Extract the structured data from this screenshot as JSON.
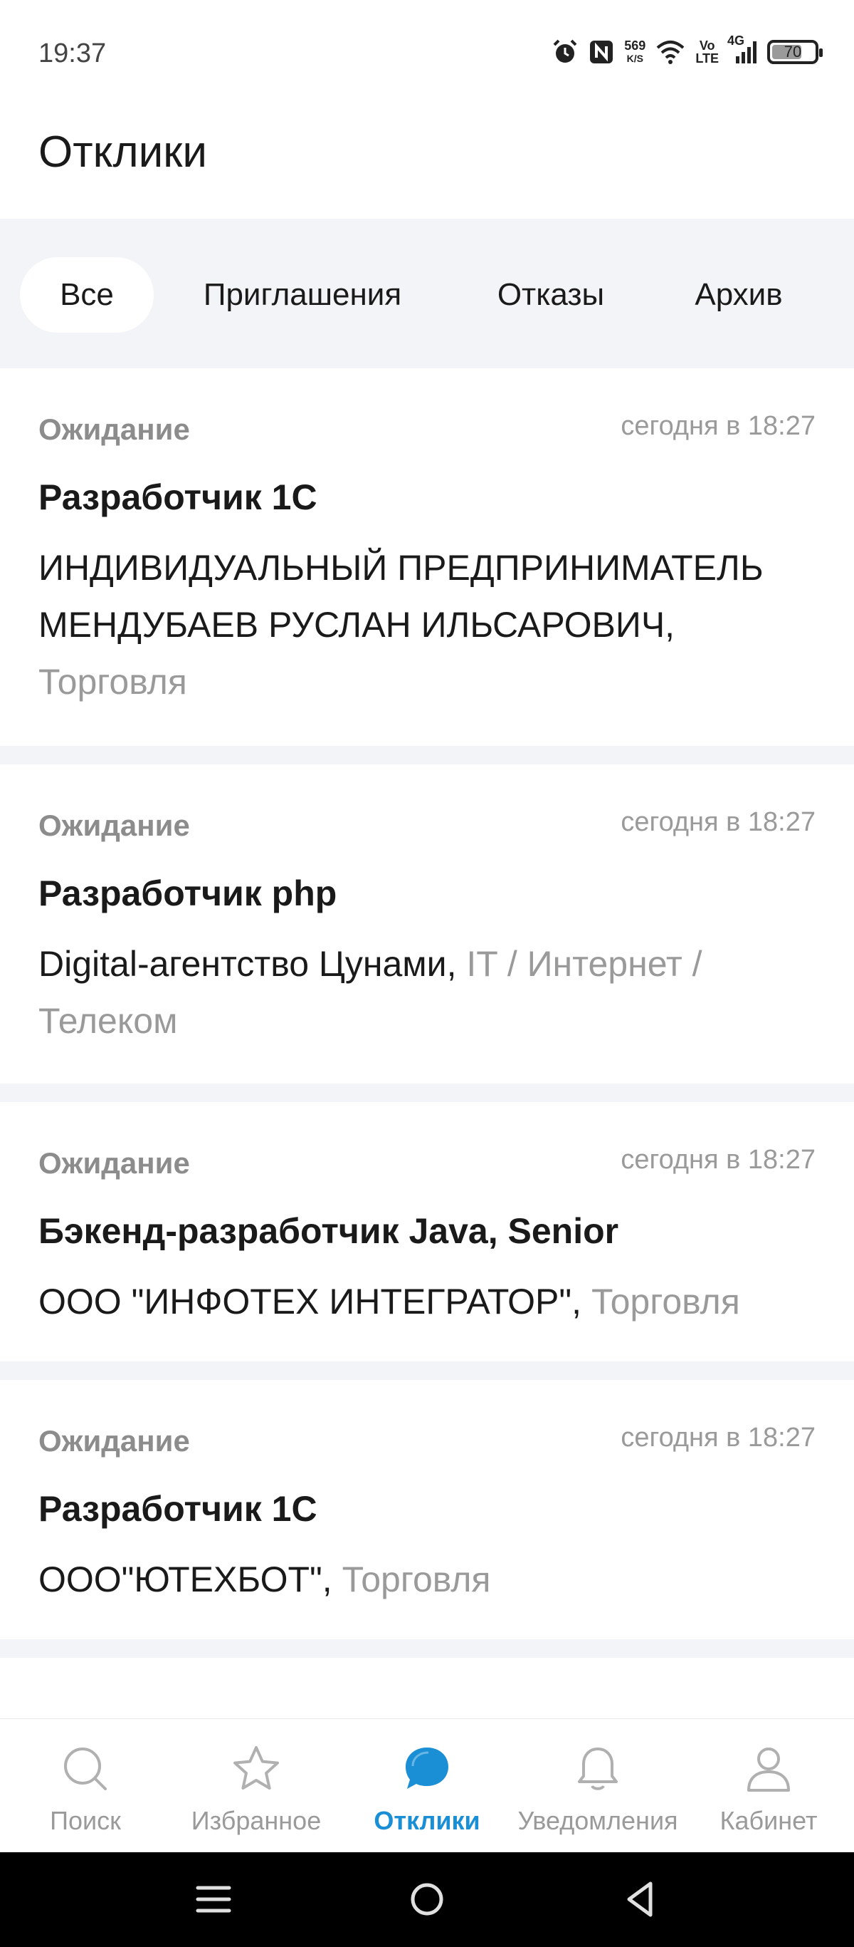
{
  "status_bar": {
    "time": "19:37",
    "net_speed_value": "569",
    "net_speed_unit": "K/S",
    "volte_top": "Vo",
    "volte_bottom": "LTE",
    "network": "4G",
    "battery": "70",
    "icons": [
      "alarm-icon",
      "nfc-icon",
      "wifi-icon",
      "signal-icon",
      "battery-icon"
    ]
  },
  "header": {
    "title": "Отклики"
  },
  "tabs": [
    {
      "label": "Все",
      "active": true
    },
    {
      "label": "Приглашения",
      "active": false
    },
    {
      "label": "Отказы",
      "active": false
    },
    {
      "label": "Архив",
      "active": false
    }
  ],
  "responses": [
    {
      "status": "Ожидание",
      "time": "сегодня в 18:27",
      "title": "Разработчик 1С",
      "company": "ИНДИВИДУАЛЬНЫЙ ПРЕДПРИНИМАТЕЛЬ МЕНДУБАЕВ РУСЛАН ИЛЬСАРОВИЧ, ",
      "industry": "Торговля"
    },
    {
      "status": "Ожидание",
      "time": "сегодня в 18:27",
      "title": "Разработчик php",
      "company": "Digital-агентство Цунами, ",
      "industry": "IT / Интернет / Телеком"
    },
    {
      "status": "Ожидание",
      "time": "сегодня в 18:27",
      "title": "Бэкенд-разработчик Java, Senior",
      "company": "ООО \"ИНФОТЕХ ИНТЕГРАТОР\", ",
      "industry": "Торговля"
    },
    {
      "status": "Ожидание",
      "time": "сегодня в 18:27",
      "title": "Разработчик 1С",
      "company": "ООО\"ЮТЕХБОТ\", ",
      "industry": "Торговля"
    }
  ],
  "bottom_nav": [
    {
      "label": "Поиск",
      "icon": "search-icon",
      "active": false
    },
    {
      "label": "Избранное",
      "icon": "star-icon",
      "active": false
    },
    {
      "label": "Отклики",
      "icon": "chat-bubble-icon",
      "active": true
    },
    {
      "label": "Уведомления",
      "icon": "bell-icon",
      "active": false
    },
    {
      "label": "Кабинет",
      "icon": "profile-icon",
      "active": false
    }
  ],
  "colors": {
    "accent": "#1a8fd6",
    "background": "#f2f4f7",
    "muted_text": "#9a9a9a",
    "primary_text": "#1a1a1a"
  }
}
